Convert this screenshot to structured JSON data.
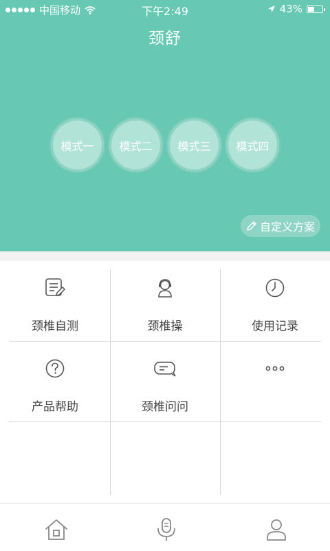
{
  "status_bar": {
    "carrier": "中国移动",
    "time": "下午2:49",
    "battery": "43%",
    "battery_level": 0.43
  },
  "header": {
    "title": "颈舒"
  },
  "modes": [
    "模式一",
    "模式二",
    "模式三",
    "模式四"
  ],
  "custom_plan": {
    "label": "自定义方案",
    "icon": "pencil-icon"
  },
  "grid": [
    {
      "label": "颈椎自测",
      "icon": "document-edit-icon"
    },
    {
      "label": "颈椎操",
      "icon": "headset-person-icon"
    },
    {
      "label": "使用记录",
      "icon": "clock-icon"
    },
    {
      "label": "产品帮助",
      "icon": "question-circle-icon"
    },
    {
      "label": "颈椎问问",
      "icon": "chat-bubble-icon"
    },
    {
      "label": "",
      "icon": "more-icon"
    }
  ],
  "tabbar": [
    {
      "icon": "home-icon"
    },
    {
      "icon": "microphone-icon"
    },
    {
      "icon": "user-icon"
    }
  ],
  "colors": {
    "accent": "#67c9b3",
    "mode_bg": "#b2e3d7"
  }
}
